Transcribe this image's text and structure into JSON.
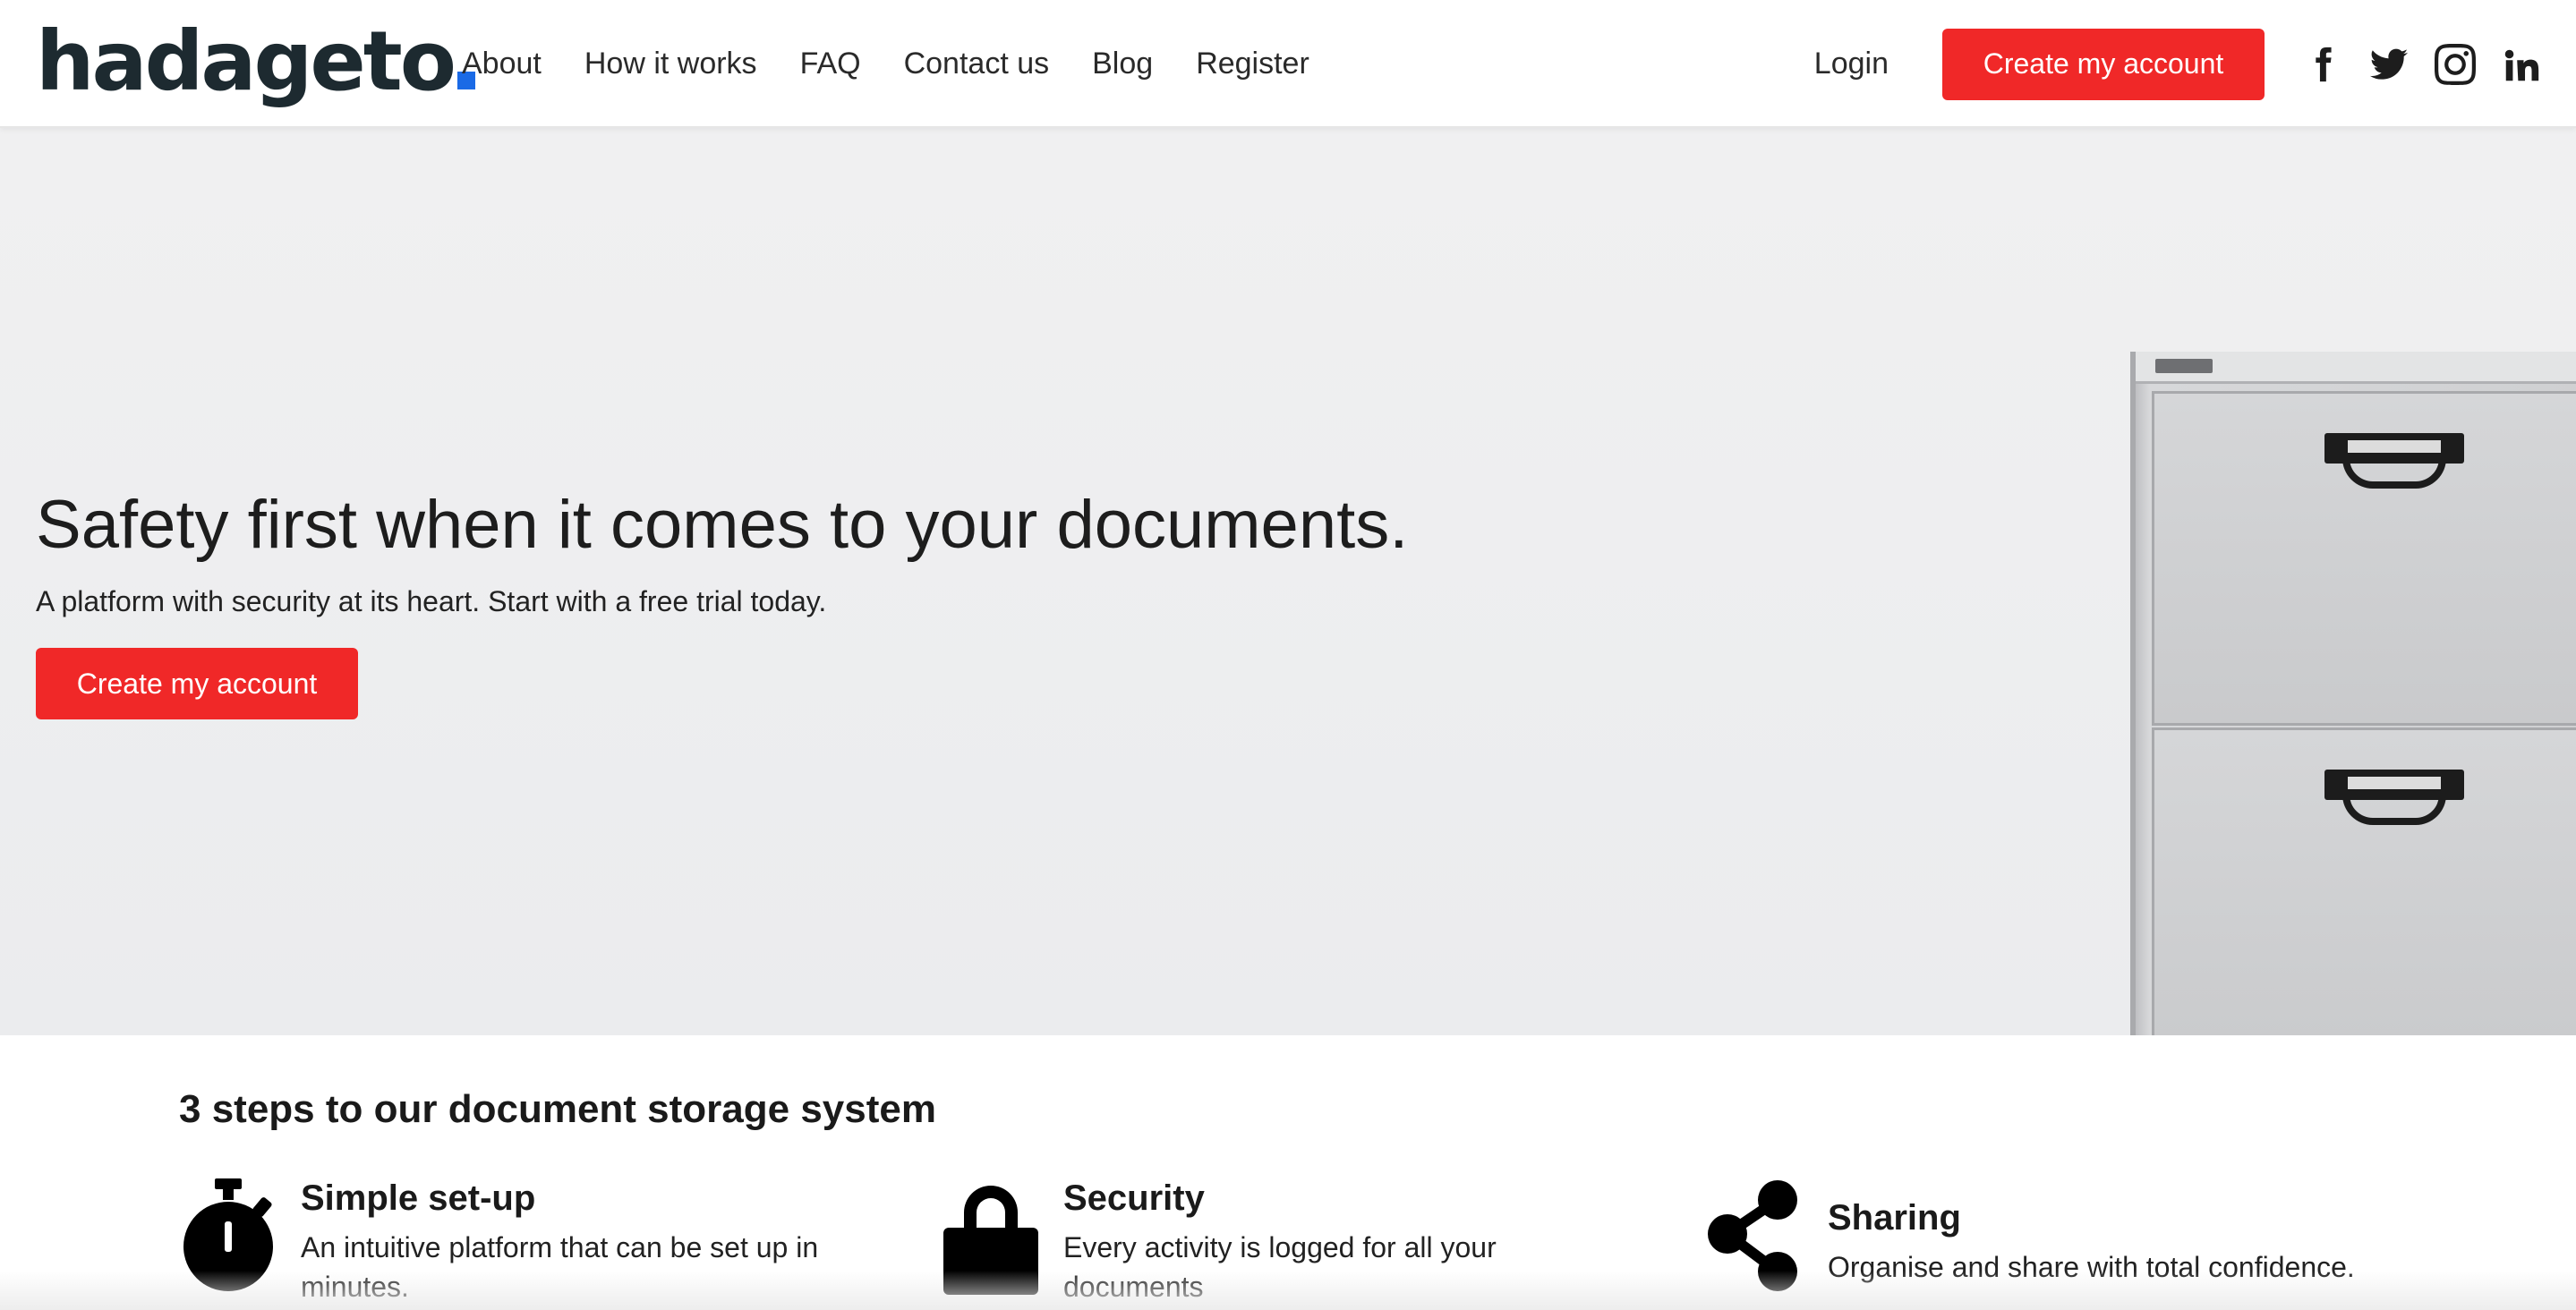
{
  "header": {
    "logo_text": "hadageto",
    "nav": [
      {
        "label": "About"
      },
      {
        "label": "How it works"
      },
      {
        "label": "FAQ"
      },
      {
        "label": "Contact us"
      },
      {
        "label": "Blog"
      },
      {
        "label": "Register"
      }
    ],
    "login_label": "Login",
    "cta_label": "Create my account",
    "social": [
      "facebook-icon",
      "twitter-icon",
      "instagram-icon",
      "linkedin-icon"
    ]
  },
  "hero": {
    "title": "Safety first when it comes to your documents.",
    "subtitle": "A platform with security at its heart. Start with a free trial today.",
    "cta_label": "Create my account",
    "image": "filing-cabinet"
  },
  "steps": {
    "title": "3 steps to our document storage system",
    "items": [
      {
        "icon": "stopwatch-icon",
        "heading": "Simple set-up",
        "description": "An intuitive platform that can be set up in minutes."
      },
      {
        "icon": "lock-icon",
        "heading": "Security",
        "description": "Every activity is logged for all your documents"
      },
      {
        "icon": "share-icon",
        "heading": "Sharing",
        "description": "Organise and share with total confidence."
      }
    ]
  },
  "colors": {
    "accent_red": "#f02828",
    "logo_dot_blue": "#1a6ae6",
    "text_dark": "#1a1a1a",
    "hero_bg": "#eeeeef"
  }
}
